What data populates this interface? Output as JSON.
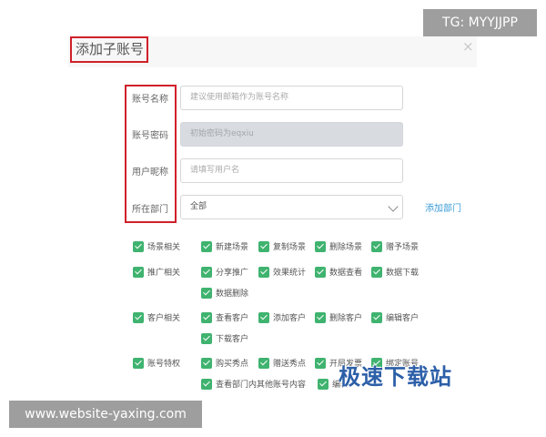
{
  "dialog": {
    "title": "添加子账号",
    "close": "×"
  },
  "form": {
    "account_name": {
      "label": "账号名称",
      "placeholder": "建议使用邮箱作为账号名称"
    },
    "password": {
      "label": "账号密码",
      "value": "初始密码为eqxiu"
    },
    "nickname": {
      "label": "用户昵称",
      "placeholder": "请填写用户名"
    },
    "department": {
      "label": "所在部门",
      "selected": "全部",
      "add_link": "添加部门"
    }
  },
  "permissions": {
    "scene": {
      "main": "场景相关",
      "items": [
        "新建场景",
        "复制场景",
        "删除场景",
        "赠予场景"
      ]
    },
    "promotion": {
      "main": "推广相关",
      "items": [
        "分享推广",
        "效果统计",
        "数据查看",
        "数据下载",
        "数据删除"
      ]
    },
    "customer": {
      "main": "客户相关",
      "items": [
        "查看客户",
        "添加客户",
        "删除客户",
        "编辑客户",
        "下载客户"
      ]
    },
    "account": {
      "main": "账号特权",
      "items": [
        "购买秀点",
        "赠送秀点",
        "开局发票",
        "绑定账号",
        "查看部门内其他账号内容",
        "编辑"
      ]
    }
  },
  "watermarks": {
    "top_right": "TG: MYYJJPP",
    "bottom_left": "www.website-yaxing.com",
    "logo": "极速下载站"
  },
  "colors": {
    "accent_red": "#d0202a",
    "check_green": "#3fb36f",
    "link_blue": "#3a9bd8"
  }
}
